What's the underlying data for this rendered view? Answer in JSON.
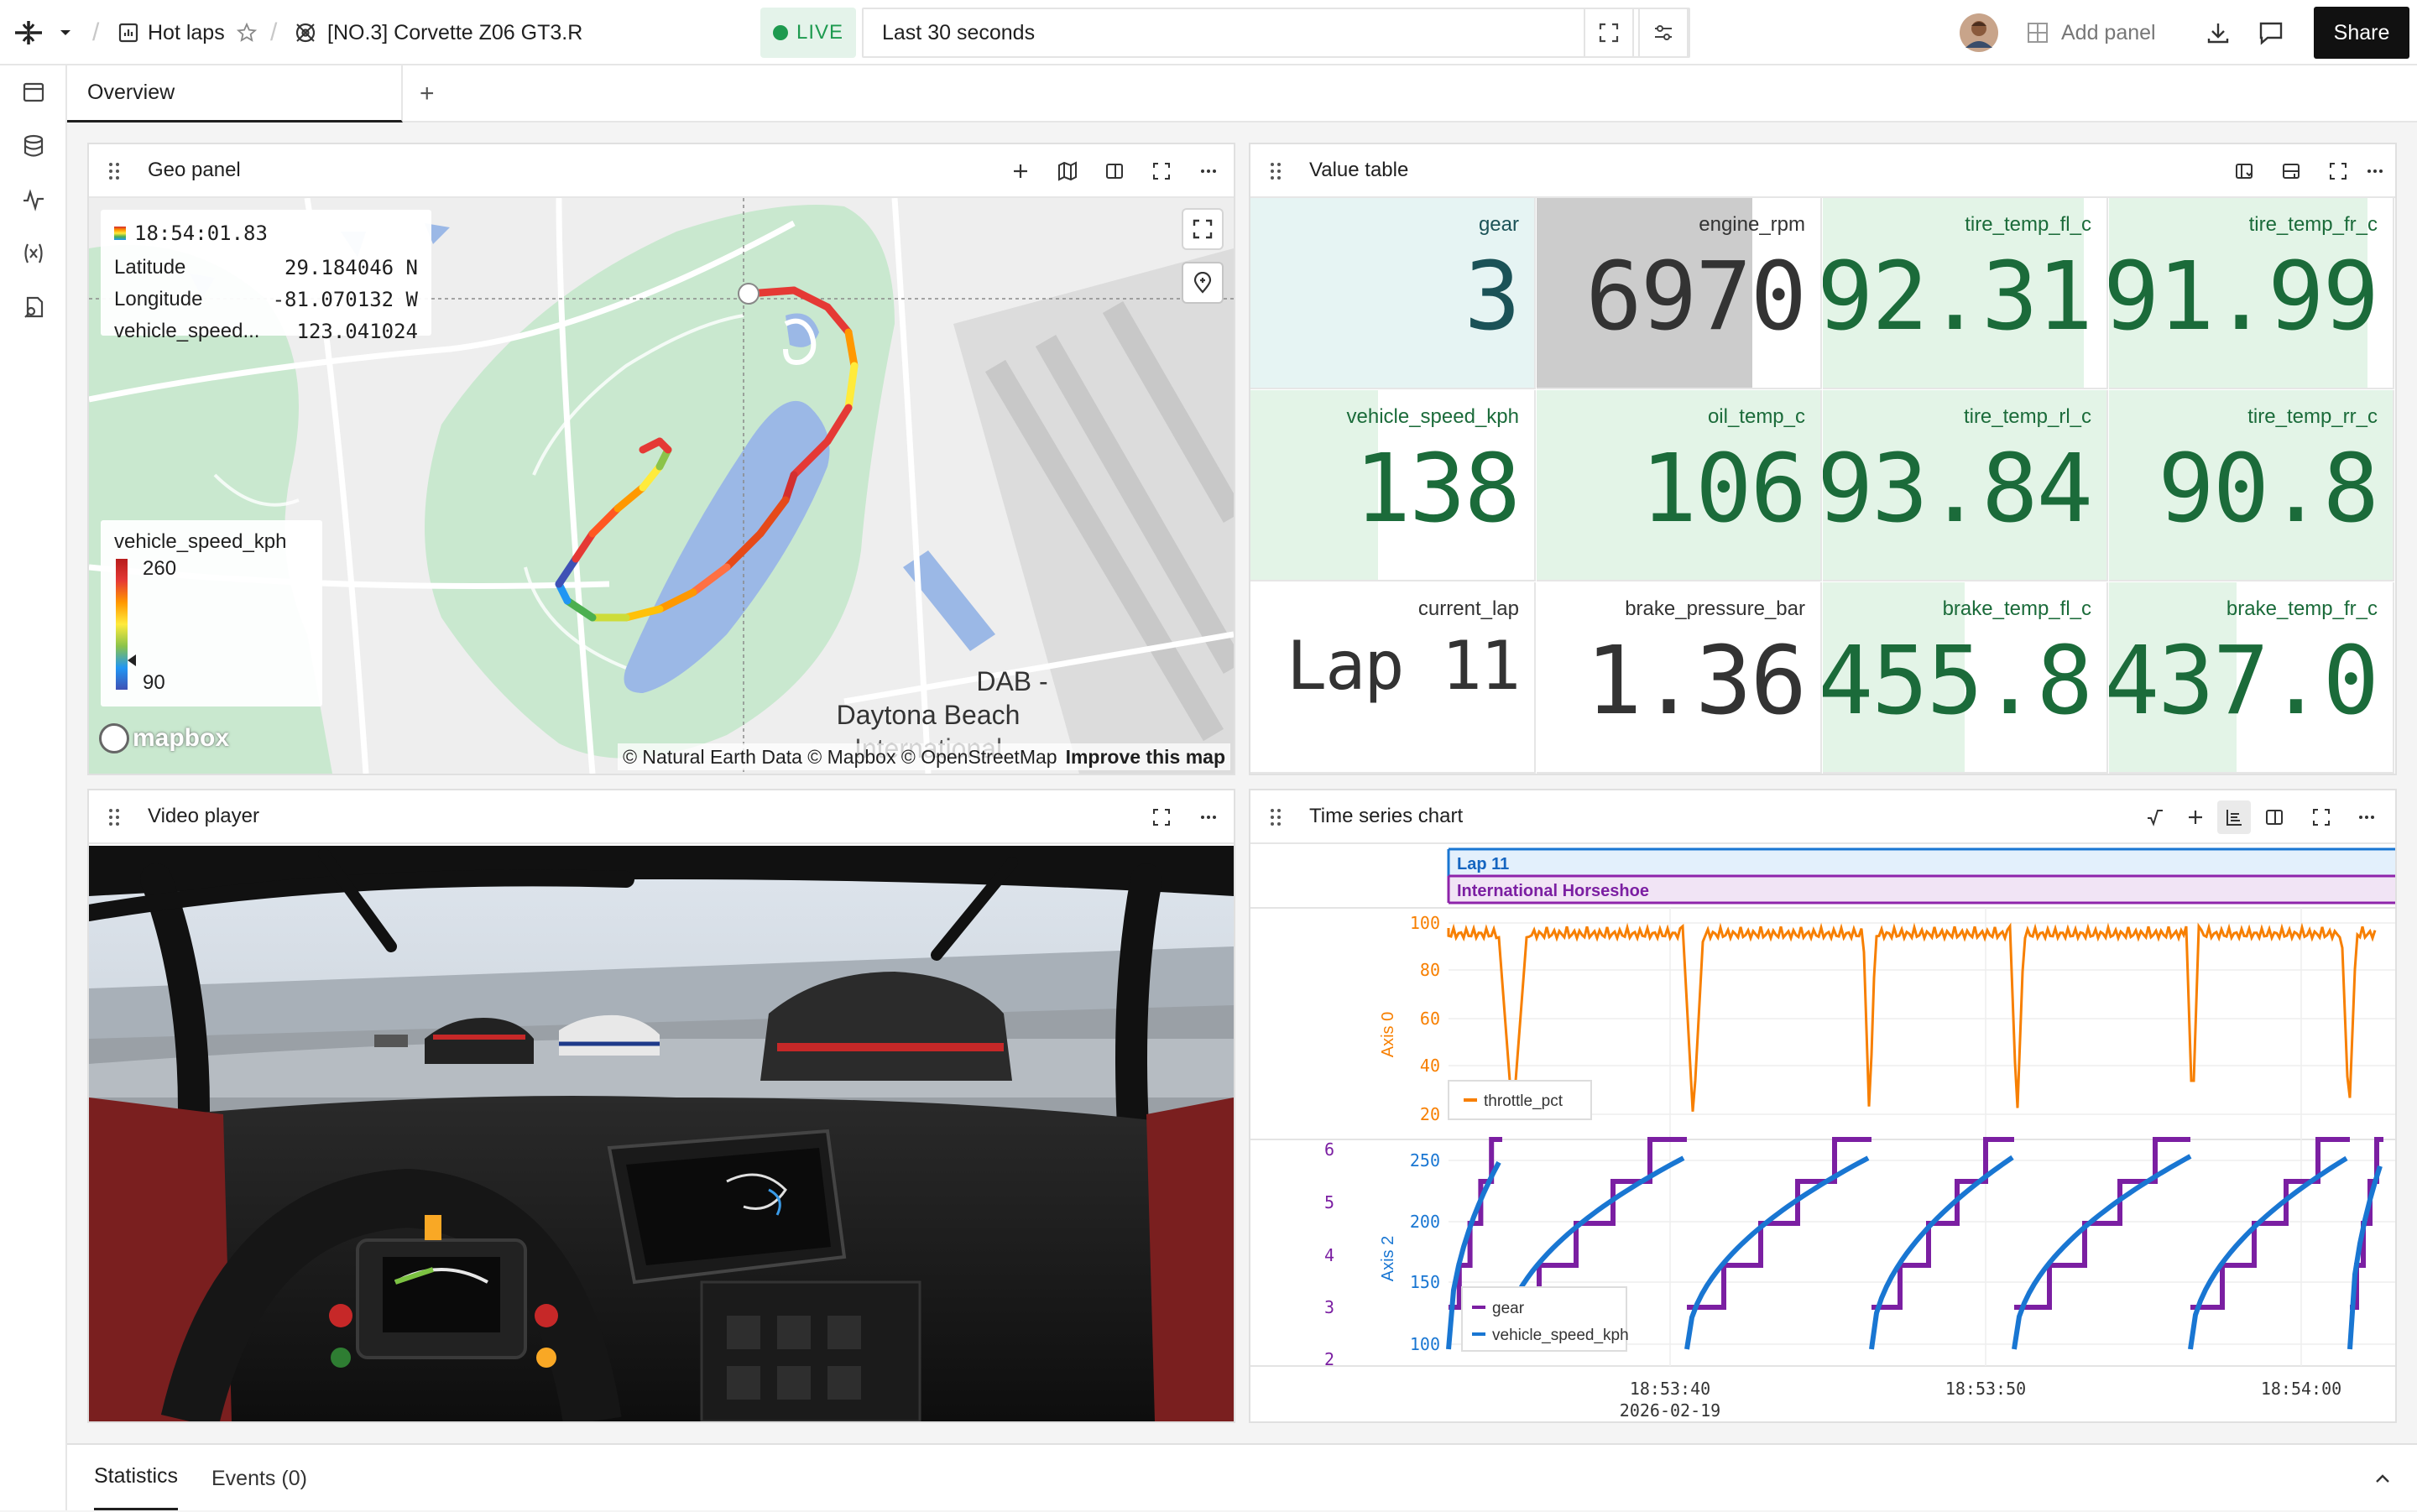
{
  "topbar": {
    "breadcrumb_1": "Hot laps",
    "breadcrumb_2": "[NO.3] Corvette Z06 GT3.R",
    "live_label": "LIVE",
    "time_range": "Last 30 seconds",
    "add_panel_label": "Add panel",
    "share_label": "Share"
  },
  "tabs": {
    "overview": "Overview",
    "add": "+"
  },
  "geo_panel": {
    "title": "Geo panel",
    "tooltip": {
      "time": "18:54:01.83",
      "rows": [
        {
          "key": "Latitude",
          "value": "29.184046 N"
        },
        {
          "key": "Longitude",
          "value": "-81.070132 W"
        },
        {
          "key": "vehicle_speed...",
          "value": "123.041024"
        }
      ]
    },
    "legend": {
      "title": "vehicle_speed_kph",
      "max": "260",
      "min": "90"
    },
    "map_label_1": "DAB -",
    "map_label_2": "Daytona Beach",
    "map_label_3": "International",
    "attribution": "© Natural Earth Data © Mapbox © OpenStreetMap",
    "improve": "Improve this map",
    "logo": "mapbox",
    "colors": {
      "park": "#c9e8cf",
      "water": "#9bb8e6",
      "land": "#eeeeee"
    }
  },
  "value_table": {
    "title": "Value table",
    "cells": [
      {
        "label": "gear",
        "value": "3",
        "fill": 1.0,
        "color": "#e6f4f3",
        "text": "#1b5257"
      },
      {
        "label": "engine_rpm",
        "value": "6970",
        "fill": 0.76,
        "color": "#cccccc",
        "text": "#333333"
      },
      {
        "label": "tire_temp_fl_c",
        "value": "92.31",
        "fill": 0.92,
        "color": "#e3f4e7",
        "text": "#1b6b3a"
      },
      {
        "label": "tire_temp_fr_c",
        "value": "91.99",
        "fill": 0.91,
        "color": "#e3f4e7",
        "text": "#1b6b3a"
      },
      {
        "label": "vehicle_speed_kph",
        "value": "138",
        "fill": 0.45,
        "color": "#e3f4e7",
        "text": "#1b6b3a"
      },
      {
        "label": "oil_temp_c",
        "value": "106",
        "fill": 1.0,
        "color": "#e3f4e7",
        "text": "#1b6b3a"
      },
      {
        "label": "tire_temp_rl_c",
        "value": "93.84",
        "fill": 1.0,
        "color": "#e3f4e7",
        "text": "#1b6b3a"
      },
      {
        "label": "tire_temp_rr_c",
        "value": "90.8",
        "fill": 1.0,
        "color": "#e3f4e7",
        "text": "#1b6b3a"
      },
      {
        "label": "current_lap",
        "value": "Lap 11",
        "fill": 0.0,
        "color": "#ffffff",
        "text": "#333333"
      },
      {
        "label": "brake_pressure_bar",
        "value": "1.36",
        "fill": 0.0,
        "color": "#ffffff",
        "text": "#333333"
      },
      {
        "label": "brake_temp_fl_c",
        "value": "455.8",
        "fill": 0.5,
        "color": "#e3f4e7",
        "text": "#1b6b3a"
      },
      {
        "label": "brake_temp_fr_c",
        "value": "437.0",
        "fill": 0.45,
        "color": "#e3f4e7",
        "text": "#1b6b3a"
      }
    ]
  },
  "video_panel": {
    "title": "Video player"
  },
  "timeseries": {
    "title": "Time series chart",
    "event_1": "Lap 11",
    "event_2": "International Horseshoe",
    "axis0_label": "Axis 0",
    "axis2_label": "Axis 2",
    "axis0_ticks": [
      "100",
      "80",
      "60",
      "40",
      "20"
    ],
    "axis2_ticks": [
      "250",
      "200",
      "150",
      "100"
    ],
    "gear_ticks": [
      "6",
      "5",
      "4",
      "3",
      "2"
    ],
    "x_ticks": [
      "18:53:40",
      "18:53:50",
      "18:54:00"
    ],
    "x_date": "2026-02-19",
    "legend_top": "throttle_pct",
    "legend_bottom_1": "gear",
    "legend_bottom_2": "vehicle_speed_kph",
    "colors": {
      "throttle": "#f77f00",
      "gear": "#7b1fa2",
      "speed": "#1976d2"
    }
  },
  "bottombar": {
    "statistics": "Statistics",
    "events": "Events (0)"
  }
}
